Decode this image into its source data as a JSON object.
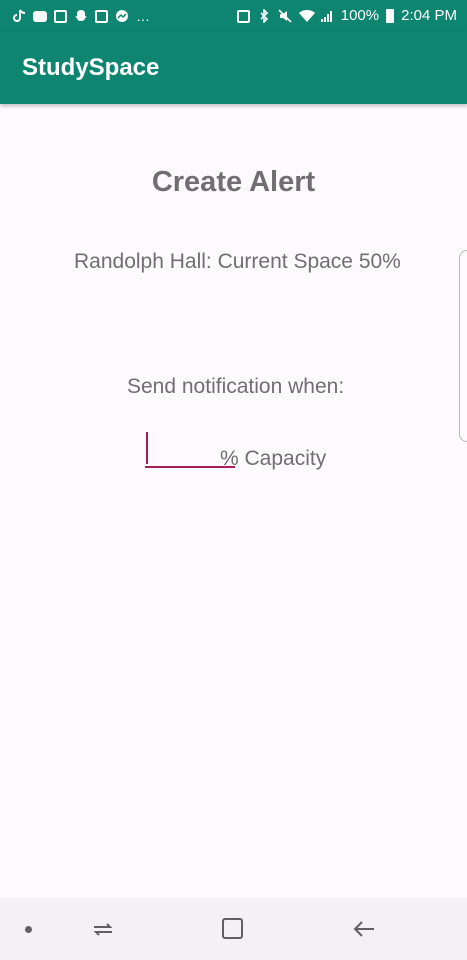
{
  "status_bar": {
    "overflow": "…",
    "battery_percent": "100%",
    "time": "2:04 PM",
    "icons_left": [
      "tiktok-icon",
      "message-icon",
      "gallery-icon",
      "snapchat-icon",
      "bitmoji-icon",
      "messenger-icon"
    ],
    "icons_right": [
      "nfc-icon",
      "bluetooth-icon",
      "mute-icon",
      "wifi-icon",
      "signal-icon",
      "battery-icon"
    ]
  },
  "app_bar": {
    "title": "StudySpace"
  },
  "main": {
    "title": "Create Alert",
    "current_space": "Randolph Hall: Current Space 50%",
    "send_label": "Send notification when:",
    "capacity_input_value": "",
    "capacity_suffix": "% Capacity"
  },
  "colors": {
    "primary": "#0d8570",
    "accent": "#a51d5a",
    "text": "#6f6f6f",
    "background": "#fdfafd"
  },
  "nav_bar": {
    "icons": [
      "dot-icon",
      "recents-icon",
      "home-icon",
      "back-icon"
    ]
  }
}
